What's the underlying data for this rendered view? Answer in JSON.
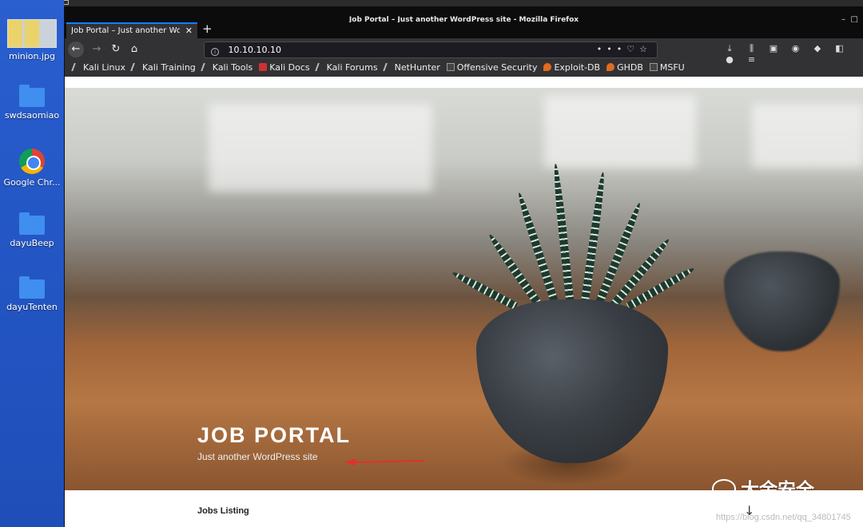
{
  "desktop": {
    "icons": [
      {
        "label": "minion.jpg",
        "type": "image"
      },
      {
        "label": "swdsaomiao",
        "type": "folder"
      },
      {
        "label": "Google Chr...",
        "type": "chrome"
      },
      {
        "label": "dayuBeep",
        "type": "folder"
      },
      {
        "label": "dayuTenten",
        "type": "folder"
      }
    ]
  },
  "browser": {
    "window_title": "Job Portal – Just another WordPress site - Mozilla Firefox",
    "tab_title": "Job Portal – Just another Wo",
    "url": "10.10.10.10",
    "bookmarks": [
      {
        "label": "Kali Linux",
        "icon": "kali"
      },
      {
        "label": "Kali Training",
        "icon": "kali"
      },
      {
        "label": "Kali Tools",
        "icon": "kali"
      },
      {
        "label": "Kali Docs",
        "icon": "red"
      },
      {
        "label": "Kali Forums",
        "icon": "kali"
      },
      {
        "label": "NetHunter",
        "icon": "kali"
      },
      {
        "label": "Offensive Security",
        "icon": "dark"
      },
      {
        "label": "Exploit-DB",
        "icon": "orange"
      },
      {
        "label": "GHDB",
        "icon": "orange"
      },
      {
        "label": "MSFU",
        "icon": "dark"
      }
    ]
  },
  "page": {
    "site_title": "JOB PORTAL",
    "tagline": "Just another WordPress site",
    "section_heading": "Jobs Listing",
    "scroll_glyph": "↓"
  },
  "overlay": {
    "watermark": "大余安全",
    "source_url": "https://blog.csdn.net/qq_34801745"
  },
  "colors": {
    "accent_tab": "#0a84ff",
    "annotation_arrow": "#e0312b"
  }
}
